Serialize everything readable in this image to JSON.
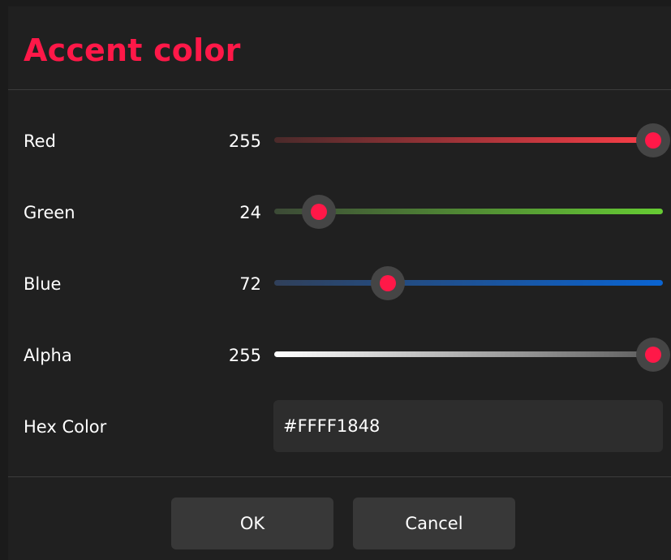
{
  "dialog": {
    "title": "Accent color",
    "accent_color": "#FF1848"
  },
  "channels": [
    {
      "label": "Red",
      "value": "255",
      "fraction": 1.0,
      "track_from": "#4a2a2a",
      "track_to": "#ff3e48"
    },
    {
      "label": "Green",
      "value": "24",
      "fraction": 0.0941,
      "track_from": "#3c4a36",
      "track_to": "#66cc33"
    },
    {
      "label": "Blue",
      "value": "72",
      "fraction": 0.2824,
      "track_from": "#30405a",
      "track_to": "#0a64d2"
    },
    {
      "label": "Alpha",
      "value": "255",
      "fraction": 1.0,
      "track_from": "#ffffff",
      "track_to": "#5a5a5a"
    }
  ],
  "hex": {
    "label": "Hex Color",
    "value": "#FFFF1848"
  },
  "buttons": {
    "ok_label": "OK",
    "cancel_label": "Cancel"
  }
}
